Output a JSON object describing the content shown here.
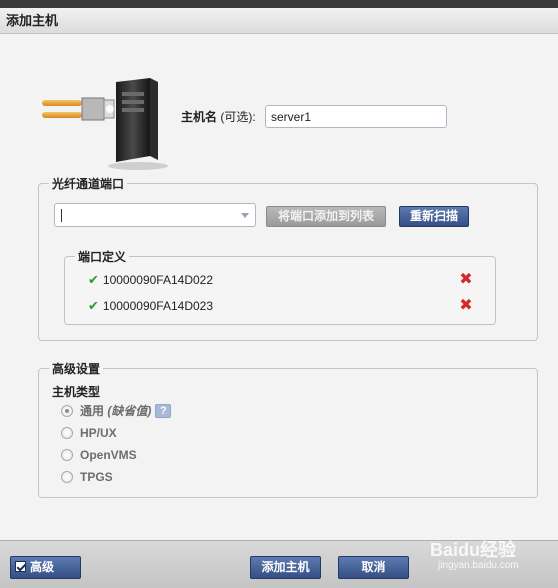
{
  "window": {
    "title": "添加主机"
  },
  "host": {
    "label_bold": "主机名",
    "label_rest": " (可选):",
    "value": "server1"
  },
  "fibre_channel": {
    "legend": "光纤通道端口",
    "combo_value": "",
    "add_button_label": "将端口添加到列表",
    "rescan_button_label": "重新扫描",
    "port_definitions": {
      "legend": "端口定义",
      "ports": [
        "10000090FA14D022",
        "10000090FA14D023"
      ]
    }
  },
  "advanced": {
    "legend": "高级设置",
    "host_type_label": "主机类型",
    "options": [
      {
        "label": "通用",
        "suffix": "(缺省值)",
        "selected": true
      },
      {
        "label": "HP/UX",
        "selected": false
      },
      {
        "label": "OpenVMS",
        "selected": false
      },
      {
        "label": "TPGS",
        "selected": false
      }
    ],
    "help_glyph": "?"
  },
  "footer": {
    "advanced_label": "高级",
    "add_host_label": "添加主机",
    "cancel_label": "取消"
  },
  "watermark": {
    "line1": "Baidu经验",
    "line2": "jingyan.baidu.com"
  },
  "colors": {
    "accent_button": "#3c5a8f",
    "check": "#2b9a2b",
    "delete": "#d12a2a"
  },
  "icons": {
    "server": "server-fiber-icon",
    "check": "check-icon",
    "delete": "delete-x-icon",
    "help": "help-icon"
  }
}
